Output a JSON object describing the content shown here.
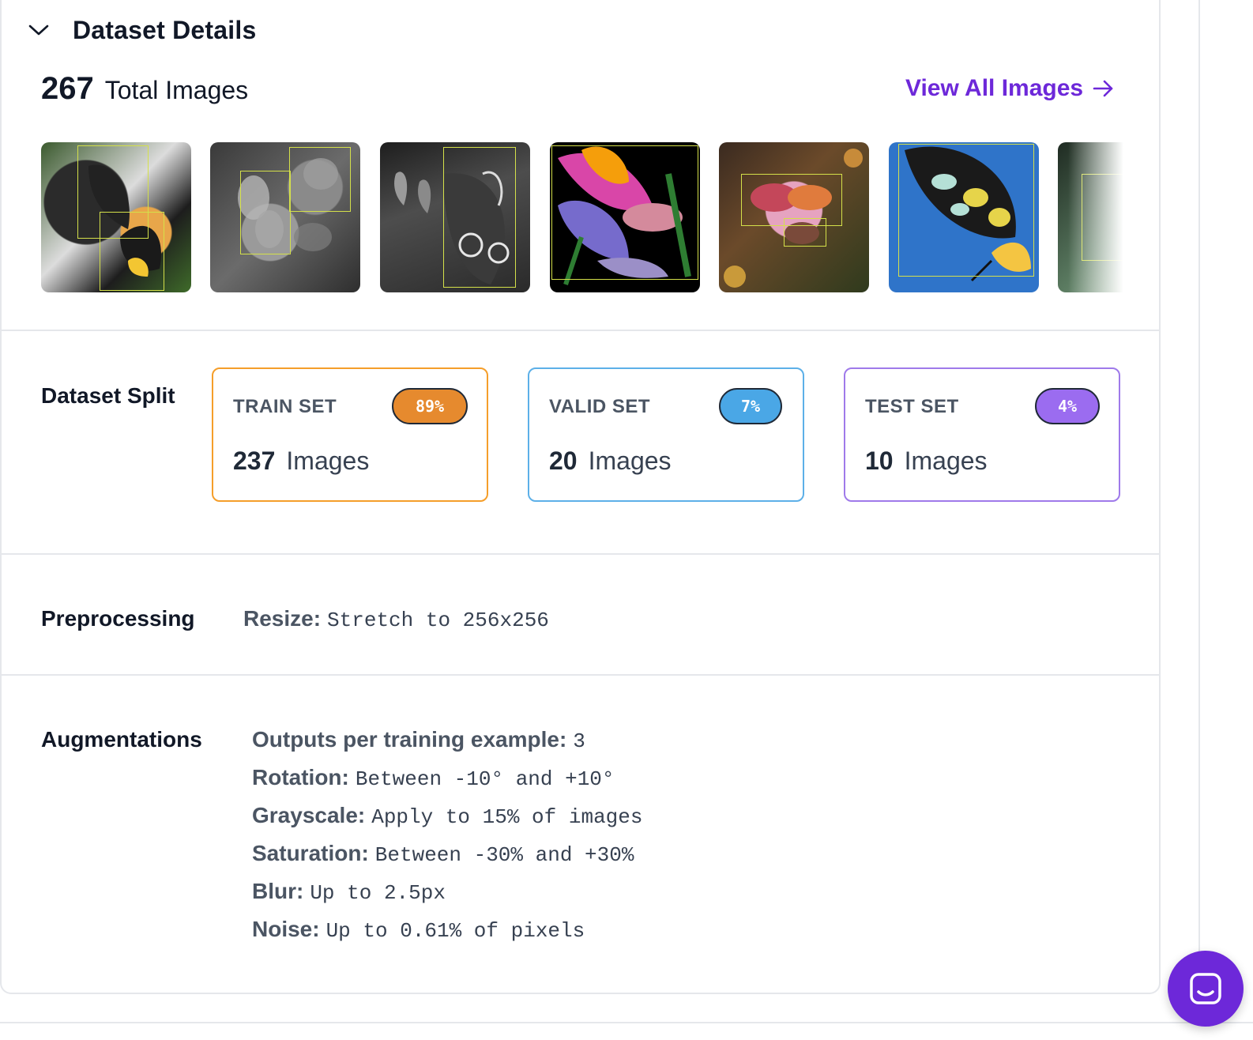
{
  "section": {
    "title": "Dataset Details"
  },
  "summary": {
    "total_count": "267",
    "total_label": "Total Images",
    "view_all_label": "View All Images"
  },
  "thumbnails": [
    {
      "name": "thumbnail-1"
    },
    {
      "name": "thumbnail-2"
    },
    {
      "name": "thumbnail-3"
    },
    {
      "name": "thumbnail-4"
    },
    {
      "name": "thumbnail-5"
    },
    {
      "name": "thumbnail-6"
    },
    {
      "name": "thumbnail-7"
    }
  ],
  "split": {
    "label": "Dataset Split",
    "sets": [
      {
        "name": "TRAIN SET",
        "percent": "89%",
        "count": "237",
        "unit": "Images",
        "border_color": "#f59e2a",
        "badge_color": "#e68a2e"
      },
      {
        "name": "VALID SET",
        "percent": "7%",
        "count": "20",
        "unit": "Images",
        "border_color": "#5db0e8",
        "badge_color": "#4aa7e6"
      },
      {
        "name": "TEST SET",
        "percent": "4%",
        "count": "10",
        "unit": "Images",
        "border_color": "#9f7aea",
        "badge_color": "#9b6cf0"
      }
    ]
  },
  "preprocessing": {
    "label": "Preprocessing",
    "items": [
      {
        "key": "Resize:",
        "value": "Stretch to 256x256"
      }
    ]
  },
  "augmentations": {
    "label": "Augmentations",
    "items": [
      {
        "key": "Outputs per training example:",
        "value": "3"
      },
      {
        "key": "Rotation:",
        "value": "Between -10° and +10°"
      },
      {
        "key": "Grayscale:",
        "value": "Apply to 15% of images"
      },
      {
        "key": "Saturation:",
        "value": "Between -30% and +30%"
      },
      {
        "key": "Blur:",
        "value": "Up to 2.5px"
      },
      {
        "key": "Noise:",
        "value": "Up to 0.61% of pixels"
      }
    ]
  },
  "icons": {
    "collapse": "chevron-down-icon",
    "view_all": "arrow-right-icon",
    "chat": "chat-icon"
  },
  "colors": {
    "accent": "#6d28d9"
  }
}
